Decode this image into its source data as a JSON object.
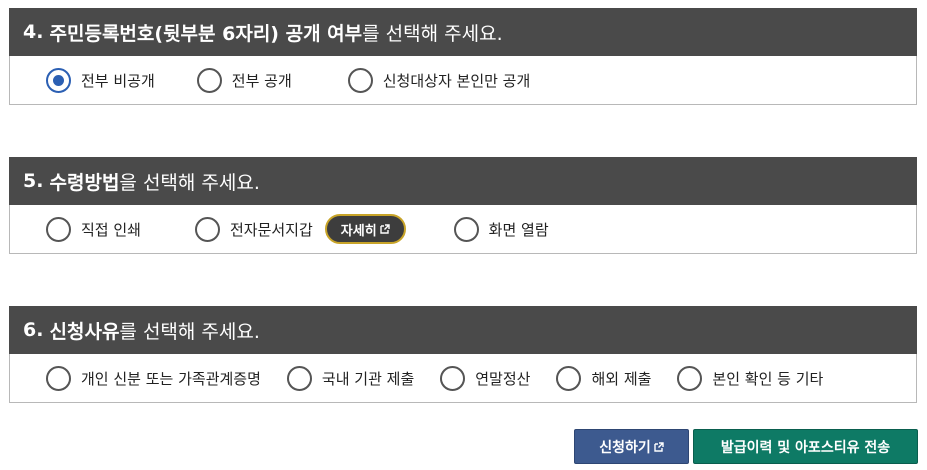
{
  "section4": {
    "number": "4.",
    "title_bold": "주민등록번호(뒷부분 6자리) 공개 여부",
    "title_rest": "를 선택해 주세요.",
    "options": [
      "전부 비공개",
      "전부 공개",
      "신청대상자 본인만 공개"
    ],
    "selected": "전부 비공개"
  },
  "section5": {
    "number": "5.",
    "title_bold": "수령방법",
    "title_rest": "을 선택해 주세요.",
    "options": [
      "직접 인쇄",
      "전자문서지갑",
      "화면 열람"
    ],
    "detail_button": "자세히"
  },
  "section6": {
    "number": "6.",
    "title_bold": "신청사유",
    "title_rest": "를 선택해 주세요.",
    "options": [
      "개인 신분 또는 가족관계증명",
      "국내 기관 제출",
      "연말정산",
      "해외 제출",
      "본인 확인 등 기타"
    ]
  },
  "footer": {
    "apply_button": "신청하기",
    "history_button": "발급이력 및 아포스티유 전송"
  },
  "colors": {
    "header_bg": "#4a4a4a",
    "radio_selected": "#2b5fb3",
    "apply_button": "#3d5a8f",
    "history_button": "#0e7a65",
    "detail_border": "#c8a428"
  },
  "icons": {
    "external": "external-link-icon"
  }
}
